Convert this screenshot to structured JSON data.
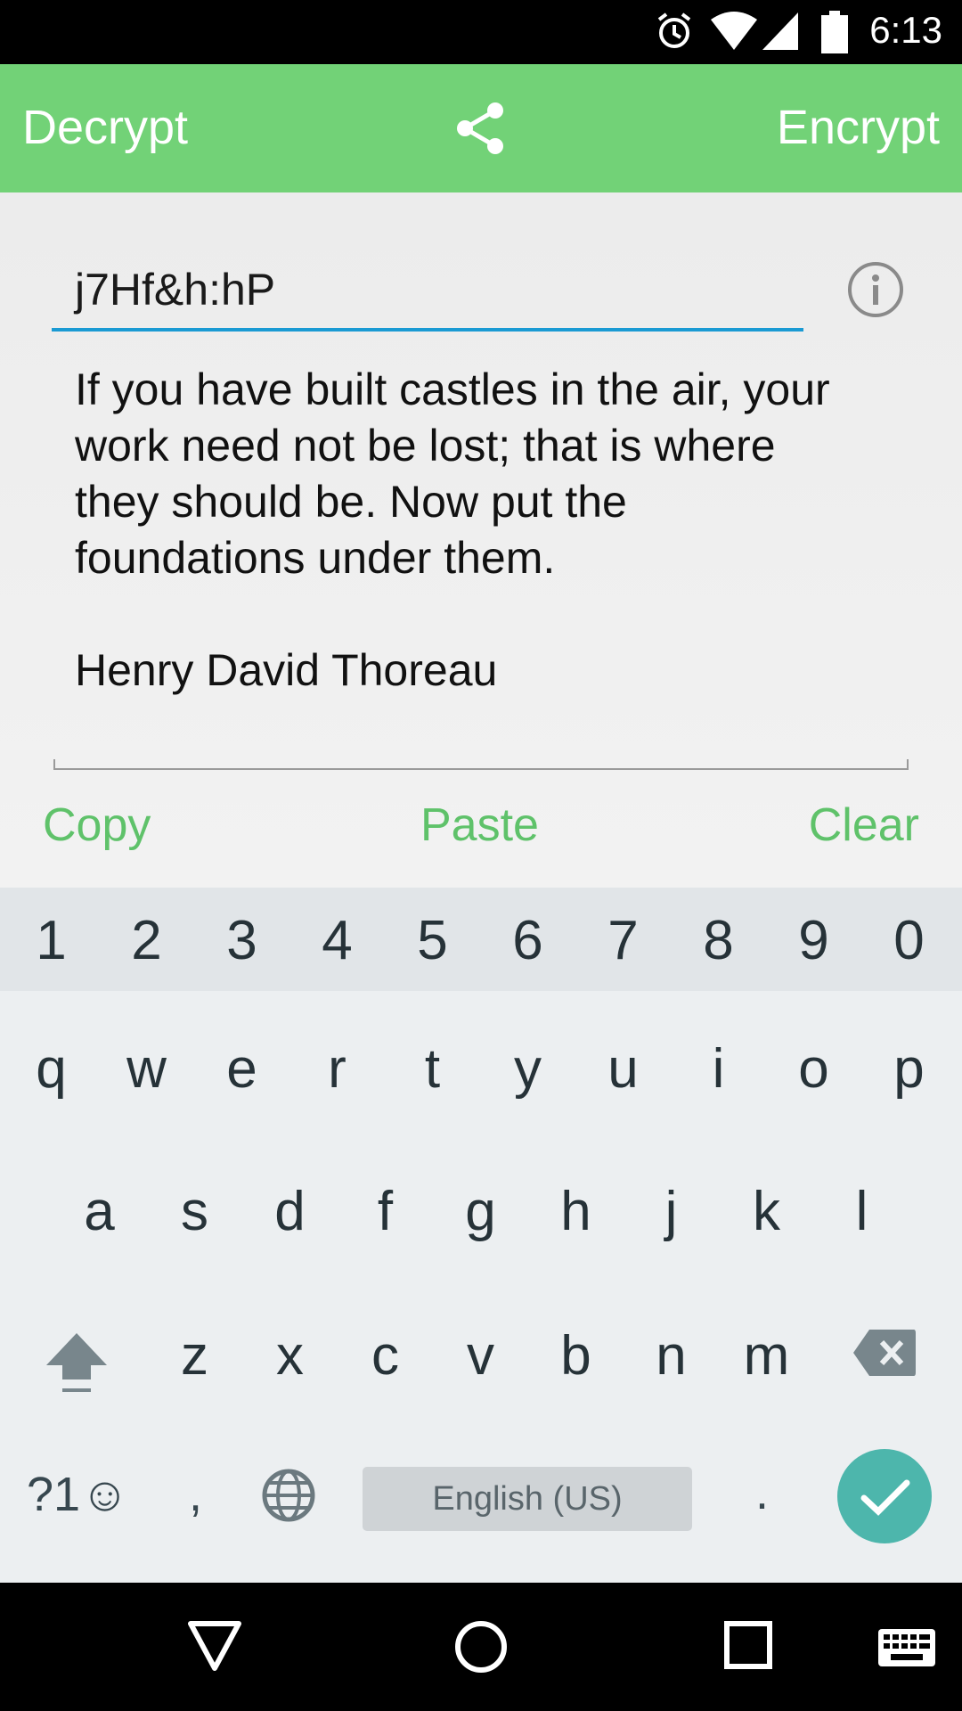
{
  "status_bar": {
    "time": "6:13",
    "icons": [
      "alarm-icon",
      "wifi-icon",
      "cell-signal-icon",
      "battery-icon"
    ]
  },
  "app_bar": {
    "decrypt_label": "Decrypt",
    "share_icon": "share-icon",
    "encrypt_label": "Encrypt",
    "background": "#72d277"
  },
  "form": {
    "password_value": "j7Hf&h:hP",
    "info_icon": "info-icon",
    "message_value": "If you have built castles in the air, your\nwork need not be lost; that is where\nthey should be. Now put the\nfoundations under them.\n\nHenry David Thoreau",
    "accent": "#1a9ad3"
  },
  "actions": {
    "copy_label": "Copy",
    "paste_label": "Paste",
    "clear_label": "Clear",
    "color": "#5fc26a"
  },
  "keyboard": {
    "numbers": [
      "1",
      "2",
      "3",
      "4",
      "5",
      "6",
      "7",
      "8",
      "9",
      "0"
    ],
    "row1": [
      "q",
      "w",
      "e",
      "r",
      "t",
      "y",
      "u",
      "i",
      "o",
      "p"
    ],
    "row2": [
      "a",
      "s",
      "d",
      "f",
      "g",
      "h",
      "j",
      "k",
      "l"
    ],
    "row3": [
      "z",
      "x",
      "c",
      "v",
      "b",
      "n",
      "m"
    ],
    "symbols_label": "?1☺",
    "comma_label": ",",
    "space_label": "English (US)",
    "period_label": ".",
    "enter_color": "#4db6ac"
  },
  "nav_bar": {
    "icons": [
      "back-icon",
      "home-icon",
      "recents-icon",
      "keyboard-icon"
    ]
  }
}
